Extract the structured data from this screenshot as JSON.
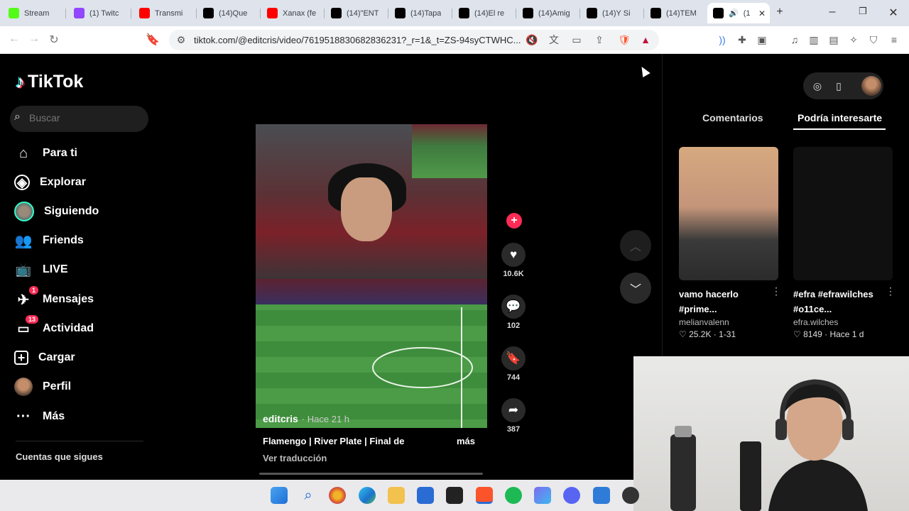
{
  "browser": {
    "tabs": [
      {
        "label": "Stream",
        "icon": "kick-icon",
        "color": "#53fc18"
      },
      {
        "label": "(1) Twitc",
        "icon": "twitch-icon",
        "color": "#9146ff"
      },
      {
        "label": "Transmi",
        "icon": "youtube-icon",
        "color": "#ff0000"
      },
      {
        "label": "(14)Que",
        "icon": "tiktok-icon",
        "color": "#000000"
      },
      {
        "label": "Xanax (fe",
        "icon": "youtube-icon",
        "color": "#ff0000"
      },
      {
        "label": "(14)\"ENT",
        "icon": "tiktok-icon",
        "color": "#000000"
      },
      {
        "label": "(14)Tapa",
        "icon": "tiktok-icon",
        "color": "#000000"
      },
      {
        "label": "(14)El re",
        "icon": "tiktok-icon",
        "color": "#000000"
      },
      {
        "label": "(14)Amig",
        "icon": "tiktok-icon",
        "color": "#000000"
      },
      {
        "label": "(14)Y Si",
        "icon": "tiktok-icon",
        "color": "#000000"
      },
      {
        "label": "(14)TEM",
        "icon": "tiktok-icon",
        "color": "#000000"
      },
      {
        "label": "(1",
        "icon": "tiktok-icon",
        "color": "#000000",
        "active": true
      }
    ],
    "new_tab": "+",
    "window_controls": {
      "minimize": "–",
      "maximize": "❐",
      "close": "✕"
    },
    "url": "tiktok.com/@editcris/video/7619518830682836231?_r=1&_t=ZS-94syCTWHC..."
  },
  "tiktok": {
    "logo_text": "TikTok",
    "search_placeholder": "Buscar",
    "nav": [
      {
        "label": "Para ti",
        "icon": "home-icon"
      },
      {
        "label": "Explorar",
        "icon": "compass-icon"
      },
      {
        "label": "Siguiendo",
        "icon": "following-avatar-icon"
      },
      {
        "label": "Friends",
        "icon": "friends-icon"
      },
      {
        "label": "LIVE",
        "icon": "live-icon"
      },
      {
        "label": "Mensajes",
        "icon": "messages-icon",
        "badge": "1"
      },
      {
        "label": "Actividad",
        "icon": "activity-icon",
        "badge": "13"
      },
      {
        "label": "Cargar",
        "icon": "upload-icon"
      },
      {
        "label": "Perfil",
        "icon": "profile-avatar-icon"
      },
      {
        "label": "Más",
        "icon": "more-icon"
      }
    ],
    "follows_title": "Cuentas que sigues",
    "video": {
      "author": "editcris",
      "time": "· Hace 21 h",
      "caption": "Flamengo | River Plate | Final de",
      "more": "más",
      "translate": "Ver traducción"
    },
    "actions": {
      "likes": "10.6K",
      "comments": "102",
      "saves": "744",
      "shares": "387"
    },
    "right_tabs": {
      "comments": "Comentarios",
      "suggestions": "Podría interesarte"
    },
    "cards": [
      {
        "title": "vamo hacerlo #prime...",
        "user": "melianvalenn",
        "stats": "♡ 25.2K · 1-31"
      },
      {
        "title": "#efra #efrawilches #o11ce...",
        "user": "efra.wilches",
        "stats": "♡ 8149 · Hace 1 d"
      }
    ]
  },
  "colors": {
    "accent": "#fe2c55",
    "background": "#000000",
    "tabbar": "#dfe3eb"
  }
}
